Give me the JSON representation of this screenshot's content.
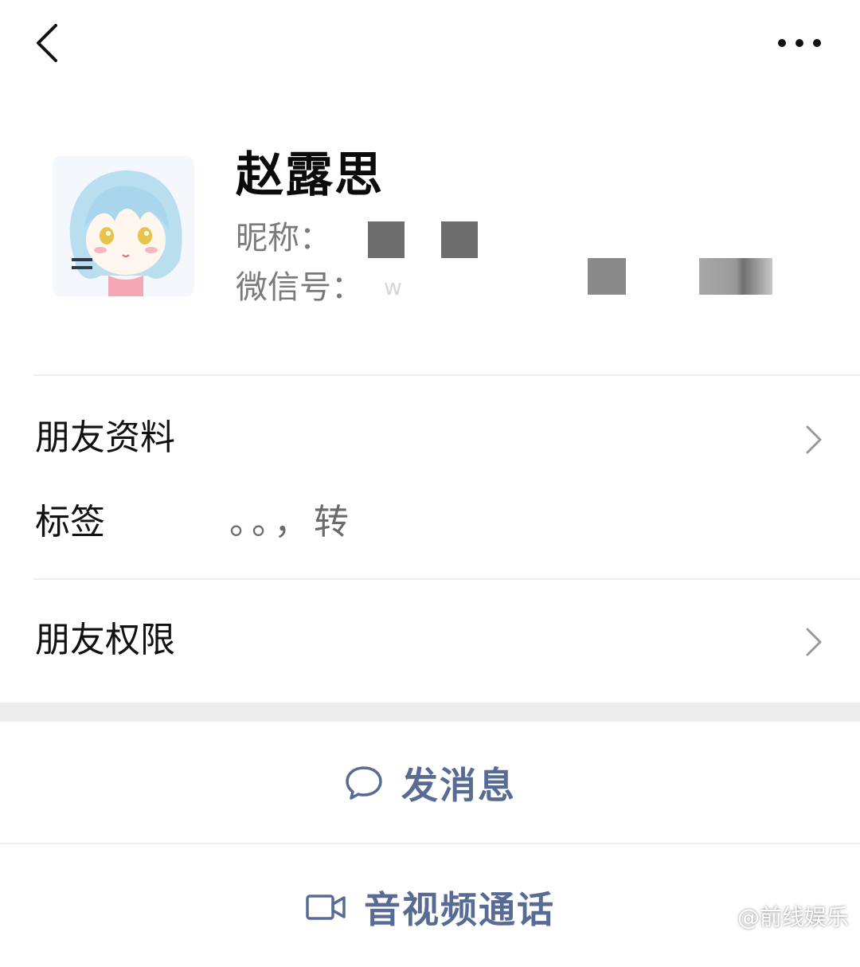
{
  "colors": {
    "link_blue": "#576b95",
    "divider": "#ececec",
    "gray_text": "#7a7a7a"
  },
  "top_bar": {
    "back_icon": "chevron-left-icon",
    "more_icon": "more-dots-icon"
  },
  "profile": {
    "name": "赵露思",
    "nickname_label": "昵称：",
    "wechat_id_label": "微信号：",
    "wechat_id_partial": "w",
    "avatar_icon": "anime-girl-avatar"
  },
  "rows": {
    "friend_profile": "朋友资料",
    "tag_label": "标签",
    "tag_value": "。。，转",
    "friend_permissions": "朋友权限"
  },
  "actions": {
    "send_message": "发消息",
    "send_message_icon": "chat-bubble-icon",
    "video_call": "音视频通话",
    "video_call_icon": "video-camera-icon"
  },
  "watermark": {
    "text": "@前线娱乐",
    "icon": "weibo-logo-icon"
  }
}
